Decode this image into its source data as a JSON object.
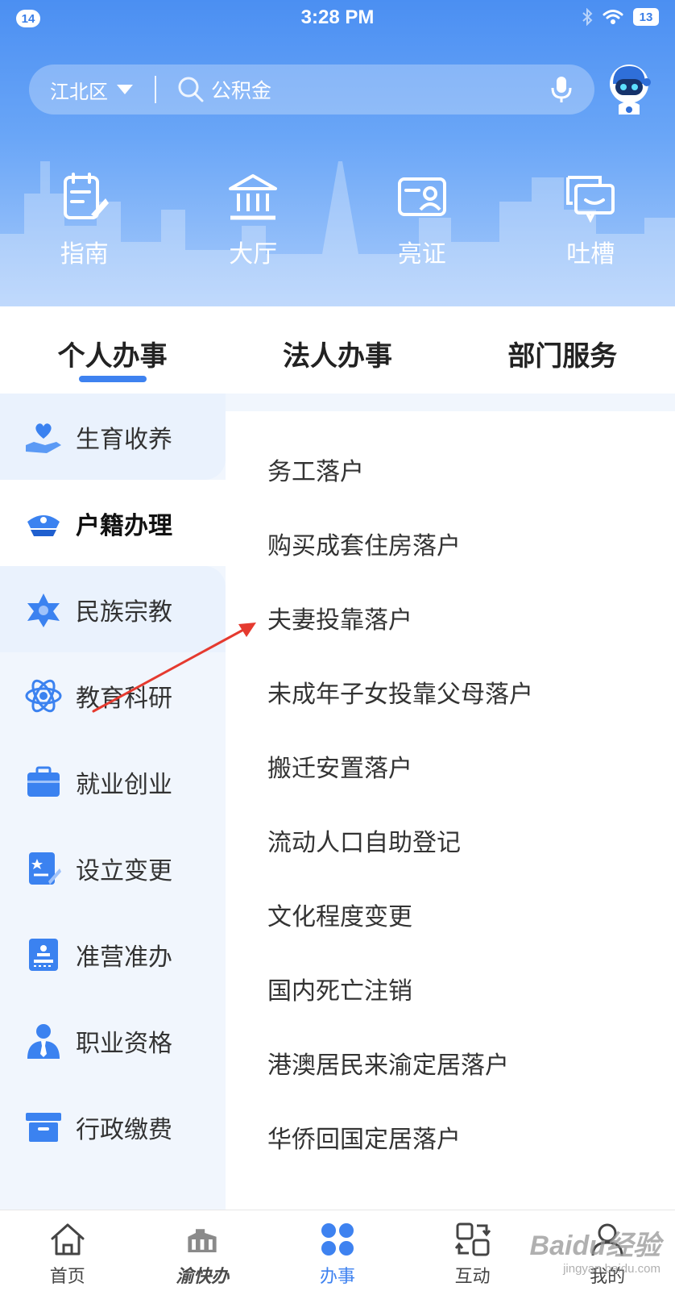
{
  "status_bar": {
    "notification_count": "14",
    "time": "3:28 PM",
    "battery": "13"
  },
  "search": {
    "district": "江北区",
    "placeholder": "公积金"
  },
  "quick_actions": [
    {
      "label": "指南",
      "icon": "guide-icon"
    },
    {
      "label": "大厅",
      "icon": "hall-icon"
    },
    {
      "label": "亮证",
      "icon": "id-card-icon"
    },
    {
      "label": "吐槽",
      "icon": "feedback-icon"
    }
  ],
  "tabs": [
    {
      "label": "个人办事",
      "active": true
    },
    {
      "label": "法人办事",
      "active": false
    },
    {
      "label": "部门服务",
      "active": false
    }
  ],
  "sidebar": {
    "active_index": 1,
    "items": [
      {
        "label": "生育收养",
        "icon": "hand-heart-icon"
      },
      {
        "label": "户籍办理",
        "icon": "police-cap-icon"
      },
      {
        "label": "民族宗教",
        "icon": "star-icon"
      },
      {
        "label": "教育科研",
        "icon": "atom-icon"
      },
      {
        "label": "就业创业",
        "icon": "briefcase-icon"
      },
      {
        "label": "设立变更",
        "icon": "certificate-icon"
      },
      {
        "label": "准营准办",
        "icon": "stamp-icon"
      },
      {
        "label": "职业资格",
        "icon": "person-tie-icon"
      },
      {
        "label": "行政缴费",
        "icon": "box-icon"
      }
    ]
  },
  "sub_items": [
    "务工落户",
    "购买成套住房落户",
    "夫妻投靠落户",
    "未成年子女投靠父母落户",
    "搬迁安置落户",
    "流动人口自助登记",
    "文化程度变更",
    "国内死亡注销",
    "港澳居民来渝定居落户",
    "华侨回国定居落户"
  ],
  "bottom_nav": [
    {
      "label": "首页",
      "icon": "home-icon",
      "active": false
    },
    {
      "label": "渝快办",
      "icon": "yukuaiban-logo-icon",
      "active": false
    },
    {
      "label": "办事",
      "icon": "four-dots-icon",
      "active": true
    },
    {
      "label": "互动",
      "icon": "exchange-icon",
      "active": false
    },
    {
      "label": "我的",
      "icon": "user-icon",
      "active": false
    }
  ],
  "watermark": {
    "main": "Baidu经验",
    "sub": "jingyan.baidu.com"
  },
  "colors": {
    "accent": "#3e82f0",
    "header_top": "#4b8ff2",
    "sidebar_bg": "#eaf2fd",
    "annotation_arrow": "#e53a2f"
  }
}
